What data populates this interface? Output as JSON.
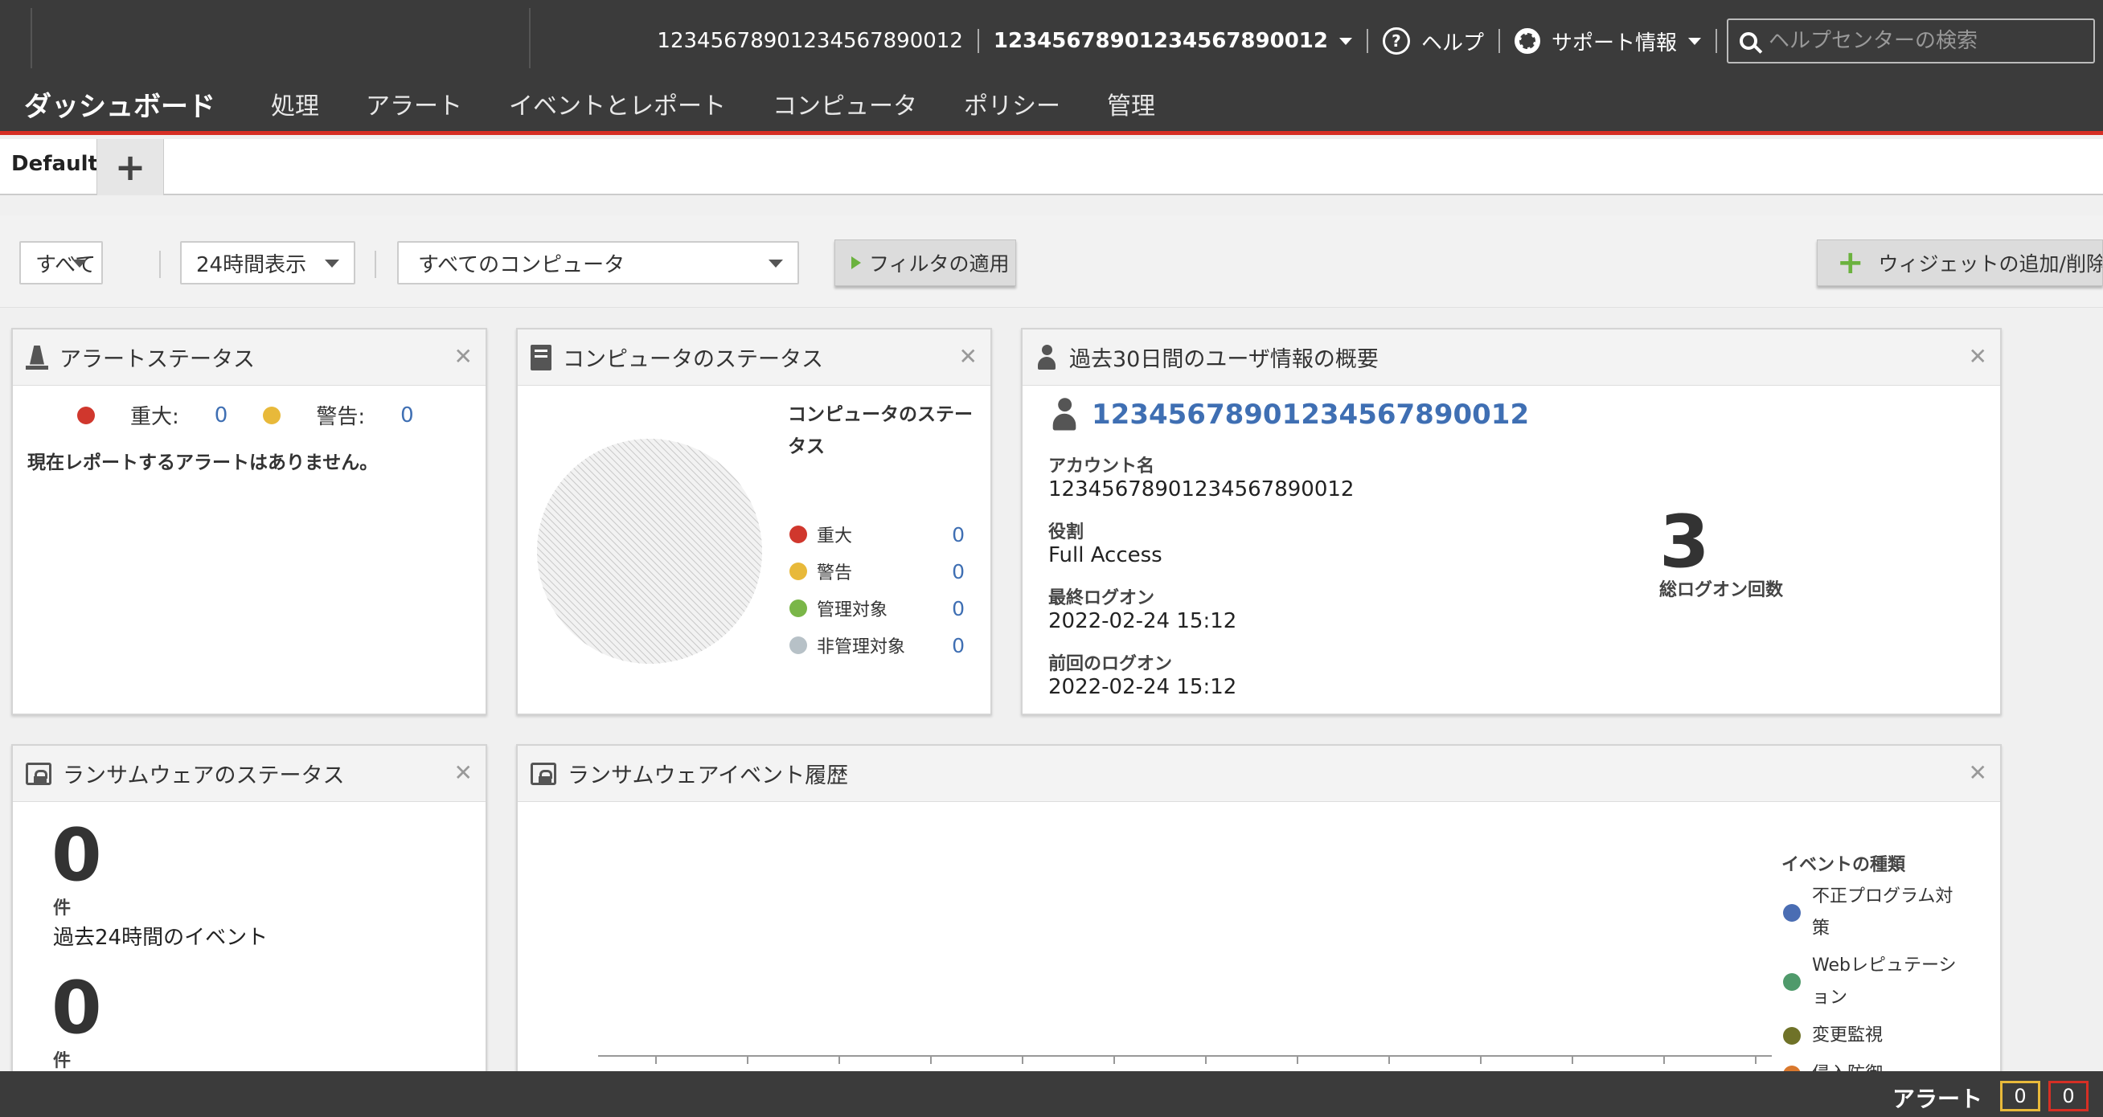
{
  "header": {
    "user_id": "12345678901234567890012",
    "account_menu": "12345678901234567890012",
    "help": "ヘルプ",
    "support": "サポート情報",
    "search_placeholder": "ヘルプセンターの検索"
  },
  "nav": {
    "logo": "ダッシュボード",
    "items": [
      "処理",
      "アラート",
      "イベントとレポート",
      "コンピュータ",
      "ポリシー",
      "管理"
    ]
  },
  "tabs": {
    "default": "Default",
    "add": "+"
  },
  "filters": {
    "scope": "すべて",
    "period": "24時間表示",
    "computers": "すべてのコンピュータ",
    "apply": "フィルタの適用",
    "add_widget": "ウィジェットの追加/削除..."
  },
  "alert_status": {
    "title": "アラートステータス",
    "critical_label": "重大:",
    "critical_count": "0",
    "warning_label": "警告:",
    "warning_count": "0",
    "message": "現在レポートするアラートはありません。"
  },
  "computer_status": {
    "title": "コンピュータのステータス",
    "legend_title": "コンピュータのステータス",
    "items": [
      {
        "label": "重大",
        "count": "0",
        "color": "#d0372d"
      },
      {
        "label": "警告",
        "count": "0",
        "color": "#e8b93a"
      },
      {
        "label": "管理対象",
        "count": "0",
        "color": "#7ab648"
      },
      {
        "label": "非管理対象",
        "count": "0",
        "color": "#b7c1c7"
      }
    ]
  },
  "user_summary": {
    "title": "過去30日間のユーザ情報の概要",
    "user_name": "12345678901234567890012",
    "account_label": "アカウント名",
    "account_value": "12345678901234567890012",
    "role_label": "役割",
    "role_value": "Full Access",
    "last_logon_label": "最終ログオン",
    "last_logon_value": "2022-02-24 15:12",
    "prev_logon_label": "前回のログオン",
    "prev_logon_value": "2022-02-24 15:12",
    "total_logons": "3",
    "total_logons_label": "総ログオン回数"
  },
  "ransomware_status": {
    "title": "ランサムウェアのステータス",
    "count1": "0",
    "unit1": "件",
    "caption1": "過去24時間のイベント",
    "count2": "0",
    "unit2": "件"
  },
  "ransomware_history": {
    "title": "ランサムウェアイベント履歴",
    "legend_title": "イベントの種類",
    "legend": [
      {
        "label": "不正プログラム対策",
        "color": "#4a6db3"
      },
      {
        "label": "Webレピュテーション",
        "color": "#4f9a6b"
      },
      {
        "label": "変更監視",
        "color": "#6f7228"
      },
      {
        "label": "侵入防御",
        "color": "#d9782d"
      }
    ]
  },
  "bottom": {
    "alert_label": "アラート",
    "warning_count": "0",
    "critical_count": "0"
  }
}
